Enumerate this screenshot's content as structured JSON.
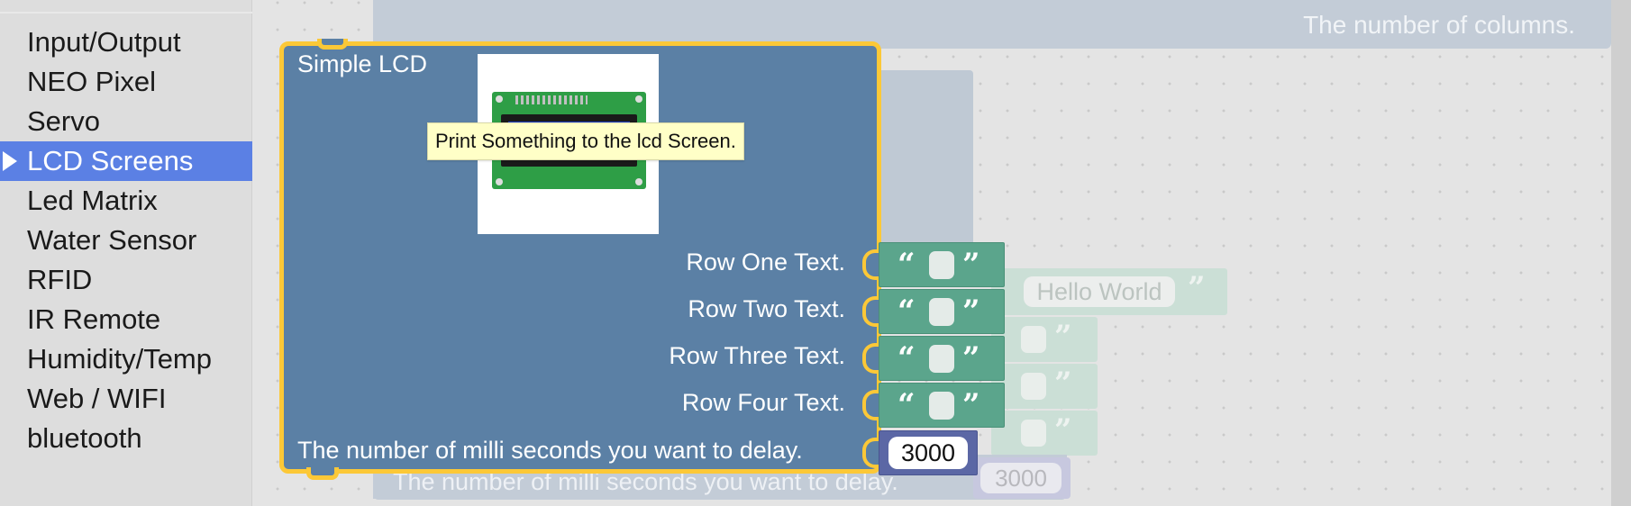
{
  "sidebar": {
    "categories": [
      {
        "label": "Input/Output"
      },
      {
        "label": "NEO Pixel"
      },
      {
        "label": "Servo"
      },
      {
        "label": "LCD Screens",
        "selected": true
      },
      {
        "label": "Led Matrix"
      },
      {
        "label": "Water Sensor"
      },
      {
        "label": "RFID"
      },
      {
        "label": "IR Remote"
      },
      {
        "label": "Humidity/Temp"
      },
      {
        "label": "Web / WIFI"
      },
      {
        "label": "bluetooth"
      }
    ]
  },
  "background_blocks": {
    "columns_label": "The number of columns.",
    "delay_label": "The number of milli seconds you want to delay.",
    "delay_value": "3000",
    "hello_text": "Hello World"
  },
  "lcd_block": {
    "title": "Simple LCD",
    "tooltip": "Print Something to the lcd Screen.",
    "rows": [
      {
        "label": "Row One Text.",
        "value": ""
      },
      {
        "label": "Row Two Text.",
        "value": ""
      },
      {
        "label": "Row Three Text.",
        "value": ""
      },
      {
        "label": "Row Four Text.",
        "value": ""
      }
    ],
    "quote_open": "“",
    "quote_close": "”",
    "delay_label": "The number of milli seconds you want to delay.",
    "delay_value": "3000"
  },
  "colors": {
    "selected_category": "#5b80e4",
    "lcd_block": "#5b80a5",
    "highlight_border": "#fcc837",
    "text_block": "#5ba58c",
    "number_block": "#5b67a5",
    "tooltip_bg": "#ffffc7"
  },
  "icons": {
    "selected_arrow": "triangle-right-icon",
    "lcd_image": "lcd-module-image"
  }
}
